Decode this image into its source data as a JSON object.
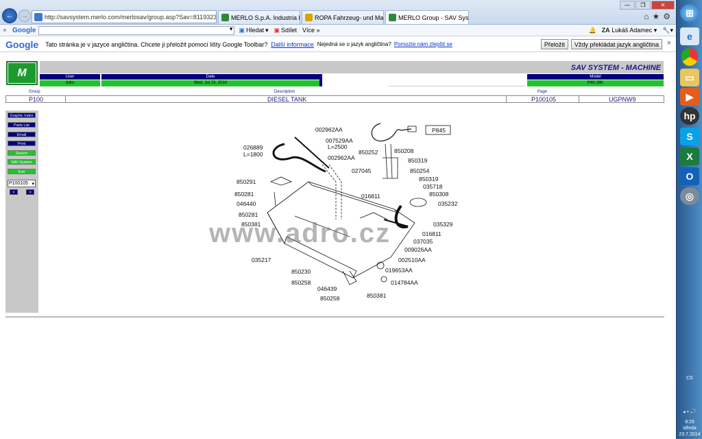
{
  "browser": {
    "address": "http://savsystem.merlo.com/merlosav/group.asp?Sav=8119323&Tela",
    "tabs": [
      {
        "label": "MERLO S.p.A. Industria Metal...",
        "active": false
      },
      {
        "label": "ROPA Fahrzeug- und Maschin...",
        "active": false
      },
      {
        "label": "MERLO Group - SAV System",
        "active": true
      }
    ],
    "tab_close": "×"
  },
  "google_toolbar": {
    "logo": "Google",
    "search_label": "Hledat",
    "share_label": "Sdílet",
    "more_label": "Více »",
    "user_label": "Lukáš Adamec ▾",
    "close": "×"
  },
  "translate_bar": {
    "logo": "Google",
    "message": "Tato stránka je v jazyce angličtina. Chcete ji přeložit pomocí lišty Google Toolbar?",
    "more_info": "Další informace",
    "not_english": "Nejedná se o jazyk angličtina?",
    "help_improve": "Pomozte nám zlepšit se",
    "translate_btn": "Přeložit",
    "always_btn": "Vždy překládat jazyk angličtina",
    "close": "×"
  },
  "header": {
    "title": "SAV SYSTEM - MACHINE",
    "user_label": "User",
    "user_value": "Adro",
    "date_label": "Date",
    "date_value": "Wed, Jul 23, 2014",
    "model_label": "Model",
    "model_value": "P40.16K"
  },
  "info": {
    "group_label": "Group",
    "group_value": "P100",
    "description_label": "Description",
    "description_value": "DIESEL TANK",
    "page_label": "Page",
    "page_value": "P100105",
    "code_value": "UGPNW9"
  },
  "sidebar": {
    "buttons": [
      {
        "label": "Graphic Index",
        "color": "blue"
      },
      {
        "label": "Parts List",
        "color": "blue"
      },
      {
        "label": "Email",
        "color": "blue"
      },
      {
        "label": "Print",
        "color": "blue"
      },
      {
        "label": "Search",
        "color": "green"
      },
      {
        "label": "SAV System",
        "color": "green"
      },
      {
        "label": "Exit",
        "color": "green"
      }
    ],
    "page_select": "P100105",
    "prev": "<",
    "next": ">"
  },
  "diagram": {
    "watermark": "www.adro.cz",
    "labels": {
      "l1": "002962AA",
      "l2": "007529AA",
      "l3": "L=2500",
      "l4": "026889",
      "l5": "L=1800",
      "l6": "002962AA",
      "l7": "P845",
      "l8": "850252",
      "l9": "850208",
      "l10": "850319",
      "l11": "027045",
      "l12": "850254",
      "l13": "850319",
      "l14": "035718",
      "l15": "016811",
      "l16": "850308",
      "l17": "035232",
      "l18": "850291",
      "l19": "850281",
      "l20": "046440",
      "l21": "850281",
      "l22": "850381",
      "l23": "035329",
      "l24": "016811",
      "l25": "037035",
      "l26": "009026AA",
      "l27": "035217",
      "l28": "002510AA",
      "l29": "850230",
      "l30": "019653AA",
      "l31": "850258",
      "l32": "014784AA",
      "l33": "046439",
      "l34": "850258",
      "l35": "850381"
    }
  },
  "taskbar": {
    "lang": "CS",
    "time": "9:29",
    "day": "středa",
    "date": "23.7.2014"
  },
  "colors": {
    "header_blue": "#00007a",
    "header_green": "#22c32e",
    "band_gray": "#c8c8c8",
    "title_blue": "#1a1a8c"
  }
}
